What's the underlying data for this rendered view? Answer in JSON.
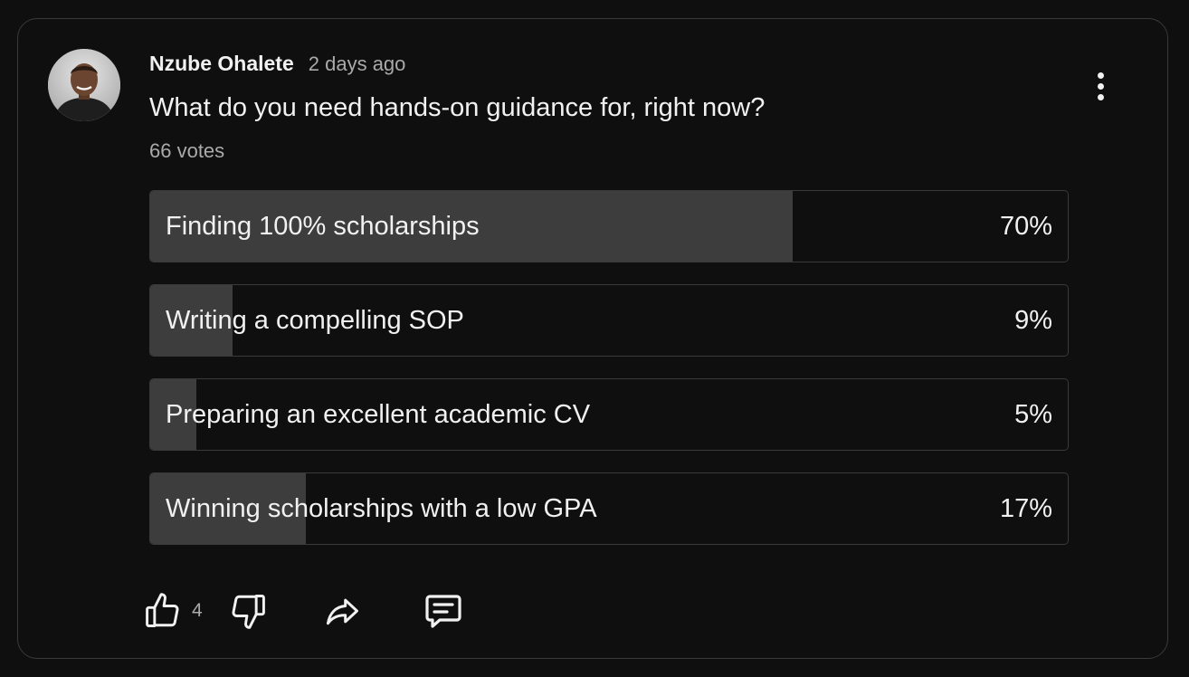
{
  "post": {
    "author": "Nzube Ohalete",
    "time": "2 days ago",
    "question": "What do you need hands-on guidance for, right now?",
    "votes": "66 votes"
  },
  "poll": {
    "options": [
      {
        "label": "Finding 100% scholarships",
        "percent": "70%",
        "share": 0.7
      },
      {
        "label": "Writing a compelling SOP",
        "percent": "9%",
        "share": 0.09
      },
      {
        "label": "Preparing an excellent academic CV",
        "percent": "5%",
        "share": 0.05
      },
      {
        "label": "Winning scholarships with a low GPA",
        "percent": "17%",
        "share": 0.17
      }
    ]
  },
  "actions": {
    "like_count": "4",
    "icons": [
      "thumbs-up-icon",
      "thumbs-down-icon",
      "share-icon",
      "comment-icon"
    ]
  },
  "colors": {
    "background": "#0f0f0f",
    "border": "#3a3a3a",
    "bar_fill": "#3d3d3d",
    "text": "#f1f1f1",
    "muted_text": "#aaaaaa"
  }
}
